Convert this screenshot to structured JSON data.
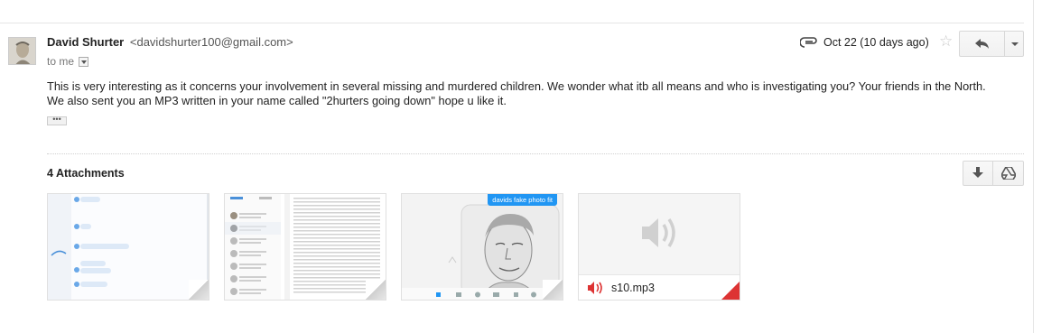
{
  "message": {
    "sender_name": "David Shurter",
    "sender_email": "<davidshurter100@gmail.com>",
    "to_label": "to me",
    "date": "Oct 22 (10 days ago)",
    "body_line1": "This is very interesting as it concerns your involvement in several missing and murdered children. We wonder what itb all means and who is investigating you? Your friends in the North.",
    "body_line2": "We also sent you an MP3 written in your name called \"2hurters going down\" hope u like it.",
    "show_trimmed": "•••"
  },
  "attachments": {
    "title": "4 Attachments",
    "items": [
      {
        "kind": "image",
        "name": "screenshot-messages-1"
      },
      {
        "kind": "image",
        "name": "screenshot-messages-2"
      },
      {
        "kind": "image",
        "label": "davids fake photo fit"
      },
      {
        "kind": "audio",
        "filename": "s10.mp3"
      }
    ]
  },
  "icons": {
    "avatar": "avatar",
    "attachment": "paperclip-icon",
    "star": "star-icon",
    "reply": "reply-icon",
    "more": "chevron-down-icon",
    "download": "download-icon",
    "drive": "google-drive-icon",
    "audio": "speaker-icon"
  },
  "colors": {
    "accent_red": "#dd3333",
    "accent_blue": "#2196f3",
    "text": "#222222",
    "muted": "#777777"
  }
}
